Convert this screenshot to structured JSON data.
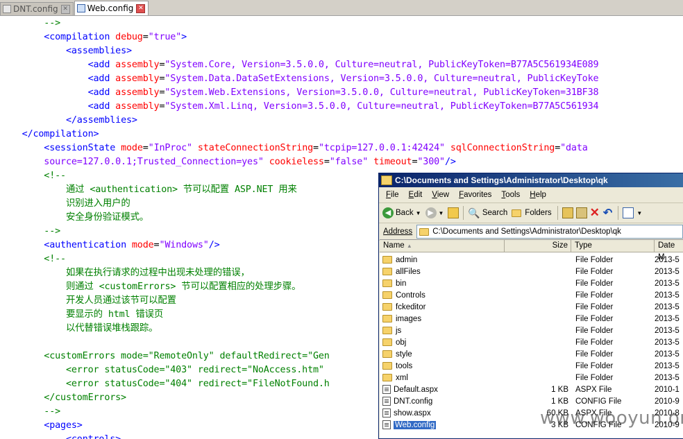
{
  "tabs": [
    {
      "label": "DNT.config",
      "active": false
    },
    {
      "label": "Web.config",
      "active": true
    }
  ],
  "code_lines": [
    [
      [
        "c",
        "        -->"
      ]
    ],
    [
      [
        "k",
        "        "
      ],
      [
        "t",
        "<compilation "
      ],
      [
        "a",
        "debug"
      ],
      [
        "k",
        "="
      ],
      [
        "v",
        "\"true\""
      ],
      [
        "t",
        ">"
      ]
    ],
    [
      [
        "k",
        "            "
      ],
      [
        "t",
        "<assemblies>"
      ]
    ],
    [
      [
        "k",
        "                "
      ],
      [
        "t",
        "<add "
      ],
      [
        "a",
        "assembly"
      ],
      [
        "k",
        "="
      ],
      [
        "v",
        "\"System.Core, Version=3.5.0.0, Culture=neutral, PublicKeyToken=B77A5C561934E089"
      ]
    ],
    [
      [
        "k",
        "                "
      ],
      [
        "t",
        "<add "
      ],
      [
        "a",
        "assembly"
      ],
      [
        "k",
        "="
      ],
      [
        "v",
        "\"System.Data.DataSetExtensions, Version=3.5.0.0, Culture=neutral, PublicKeyToke"
      ]
    ],
    [
      [
        "k",
        "                "
      ],
      [
        "t",
        "<add "
      ],
      [
        "a",
        "assembly"
      ],
      [
        "k",
        "="
      ],
      [
        "v",
        "\"System.Web.Extensions, Version=3.5.0.0, Culture=neutral, PublicKeyToken=31BF38"
      ]
    ],
    [
      [
        "k",
        "                "
      ],
      [
        "t",
        "<add "
      ],
      [
        "a",
        "assembly"
      ],
      [
        "k",
        "="
      ],
      [
        "v",
        "\"System.Xml.Linq, Version=3.5.0.0, Culture=neutral, PublicKeyToken=B77A5C561934"
      ]
    ],
    [
      [
        "k",
        "            "
      ],
      [
        "t",
        "</assemblies>"
      ]
    ],
    [
      [
        "k",
        "    "
      ],
      [
        "t",
        "</compilation>"
      ]
    ],
    [
      [
        "k",
        "        "
      ],
      [
        "t",
        "<sessionState "
      ],
      [
        "a",
        "mode"
      ],
      [
        "k",
        "="
      ],
      [
        "v",
        "\"InProc\""
      ],
      [
        "k",
        " "
      ],
      [
        "a",
        "stateConnectionString"
      ],
      [
        "k",
        "="
      ],
      [
        "v",
        "\"tcpip=127.0.0.1:42424\""
      ],
      [
        "k",
        " "
      ],
      [
        "a",
        "sqlConnectionString"
      ],
      [
        "k",
        "="
      ],
      [
        "v",
        "\"data"
      ]
    ],
    [
      [
        "v",
        "        source=127.0.0.1;Trusted_Connection=yes\""
      ],
      [
        "k",
        " "
      ],
      [
        "a",
        "cookieless"
      ],
      [
        "k",
        "="
      ],
      [
        "v",
        "\"false\""
      ],
      [
        "k",
        " "
      ],
      [
        "a",
        "timeout"
      ],
      [
        "k",
        "="
      ],
      [
        "v",
        "\"300\""
      ],
      [
        "t",
        "/>"
      ]
    ],
    [
      [
        "c",
        "        <!--"
      ]
    ],
    [
      [
        "c",
        "            通过 <authentication> 节可以配置 ASP.NET 用来"
      ]
    ],
    [
      [
        "c",
        "            识别进入用户的"
      ]
    ],
    [
      [
        "c",
        "            安全身份验证模式。"
      ]
    ],
    [
      [
        "c",
        "        -->"
      ]
    ],
    [
      [
        "k",
        "        "
      ],
      [
        "t",
        "<authentication "
      ],
      [
        "a",
        "mode"
      ],
      [
        "k",
        "="
      ],
      [
        "v",
        "\"Windows\""
      ],
      [
        "t",
        "/>"
      ]
    ],
    [
      [
        "c",
        "        <!--"
      ]
    ],
    [
      [
        "c",
        "            如果在执行请求的过程中出现未处理的错误，"
      ]
    ],
    [
      [
        "c",
        "            则通过 <customErrors> 节可以配置相应的处理步骤。"
      ]
    ],
    [
      [
        "c",
        "            开发人员通过该节可以配置"
      ]
    ],
    [
      [
        "c",
        "            要显示的 html 错误页"
      ]
    ],
    [
      [
        "c",
        "            以代替错误堆栈跟踪。"
      ]
    ],
    [
      [
        "c",
        ""
      ]
    ],
    [
      [
        "c",
        "        <customErrors mode=\"RemoteOnly\" defaultRedirect=\"Gen"
      ]
    ],
    [
      [
        "c",
        "            <error statusCode=\"403\" redirect=\"NoAccess.htm\""
      ]
    ],
    [
      [
        "c",
        "            <error statusCode=\"404\" redirect=\"FileNotFound.h"
      ]
    ],
    [
      [
        "c",
        "        </customErrors>"
      ]
    ],
    [
      [
        "c",
        "        -->"
      ]
    ],
    [
      [
        "k",
        "        "
      ],
      [
        "t",
        "<pages>"
      ]
    ],
    [
      [
        "k",
        "            "
      ],
      [
        "t",
        "<controls>"
      ]
    ]
  ],
  "explorer": {
    "title": "C:\\Documents and Settings\\Administrator\\Desktop\\qk",
    "menu": [
      "File",
      "Edit",
      "View",
      "Favorites",
      "Tools",
      "Help"
    ],
    "toolbar": {
      "back": "Back",
      "search": "Search",
      "folders": "Folders"
    },
    "address_label": "Address",
    "address": "C:\\Documents and Settings\\Administrator\\Desktop\\qk",
    "columns": {
      "name": "Name",
      "size": "Size",
      "type": "Type",
      "date": "Date M"
    },
    "items": [
      {
        "name": "admin",
        "size": "",
        "type": "File Folder",
        "date": "2013-5",
        "kind": "folder"
      },
      {
        "name": "allFiles",
        "size": "",
        "type": "File Folder",
        "date": "2013-5",
        "kind": "folder"
      },
      {
        "name": "bin",
        "size": "",
        "type": "File Folder",
        "date": "2013-5",
        "kind": "folder"
      },
      {
        "name": "Controls",
        "size": "",
        "type": "File Folder",
        "date": "2013-5",
        "kind": "folder"
      },
      {
        "name": "fckeditor",
        "size": "",
        "type": "File Folder",
        "date": "2013-5",
        "kind": "folder"
      },
      {
        "name": "images",
        "size": "",
        "type": "File Folder",
        "date": "2013-5",
        "kind": "folder"
      },
      {
        "name": "js",
        "size": "",
        "type": "File Folder",
        "date": "2013-5",
        "kind": "folder"
      },
      {
        "name": "obj",
        "size": "",
        "type": "File Folder",
        "date": "2013-5",
        "kind": "folder"
      },
      {
        "name": "style",
        "size": "",
        "type": "File Folder",
        "date": "2013-5",
        "kind": "folder"
      },
      {
        "name": "tools",
        "size": "",
        "type": "File Folder",
        "date": "2013-5",
        "kind": "folder"
      },
      {
        "name": "xml",
        "size": "",
        "type": "File Folder",
        "date": "2013-5",
        "kind": "folder"
      },
      {
        "name": "Default.aspx",
        "size": "1 KB",
        "type": "ASPX File",
        "date": "2010-1",
        "kind": "file"
      },
      {
        "name": "DNT.config",
        "size": "1 KB",
        "type": "CONFIG File",
        "date": "2010-9",
        "kind": "file"
      },
      {
        "name": "show.aspx",
        "size": "60 KB",
        "type": "ASPX File",
        "date": "2010-8",
        "kind": "file"
      },
      {
        "name": "Web.config",
        "size": "3 KB",
        "type": "CONFIG File",
        "date": "2010-9",
        "kind": "file",
        "selected": true
      }
    ]
  },
  "watermark": "www.wooyun.org"
}
